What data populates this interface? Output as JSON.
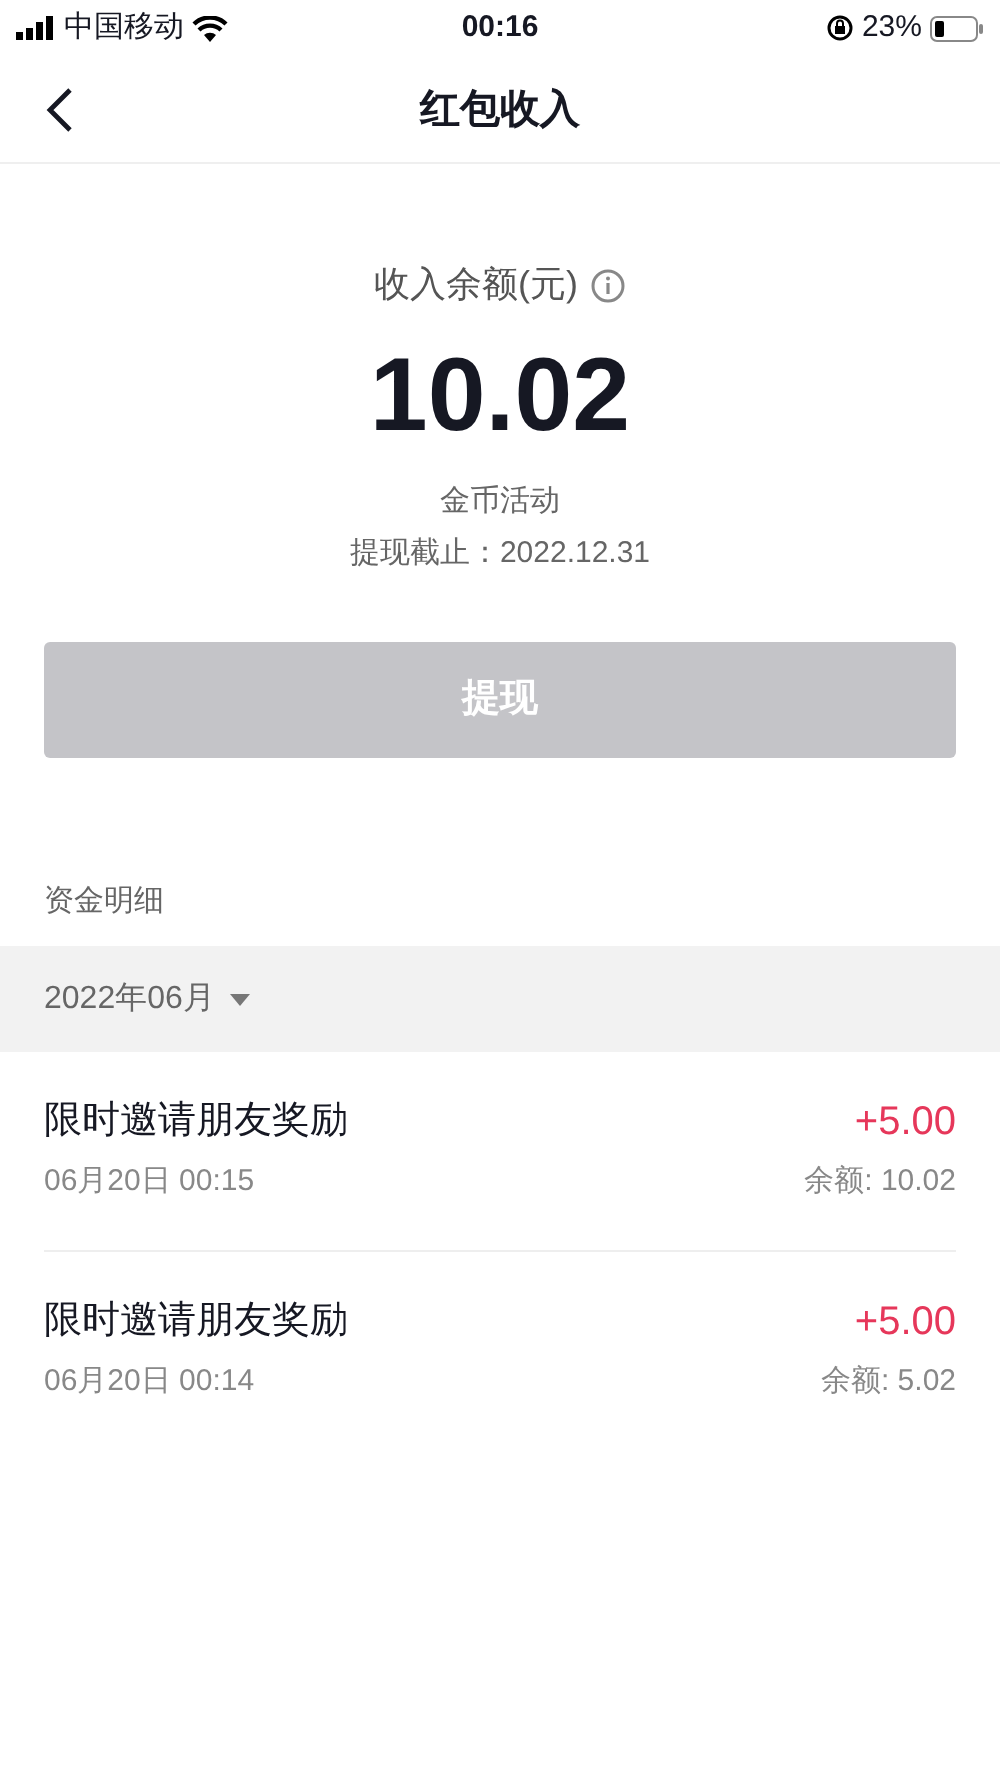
{
  "status_bar": {
    "carrier": "中国移动",
    "time": "00:16",
    "battery": "23%"
  },
  "nav": {
    "title": "红包收入"
  },
  "balance": {
    "label": "收入余额(元)",
    "amount": "10.02",
    "activity": "金币活动",
    "deadline": "提现截止：2022.12.31"
  },
  "withdraw_button": {
    "label": "提现",
    "disabled": true
  },
  "details": {
    "heading": "资金明细",
    "month": "2022年06月",
    "items": [
      {
        "title": "限时邀请朋友奖励",
        "time": "06月20日 00:15",
        "amount": "+5.00",
        "balance": "余额: 10.02"
      },
      {
        "title": "限时邀请朋友奖励",
        "time": "06月20日 00:14",
        "amount": "+5.00",
        "balance": "余额: 5.02"
      }
    ]
  }
}
